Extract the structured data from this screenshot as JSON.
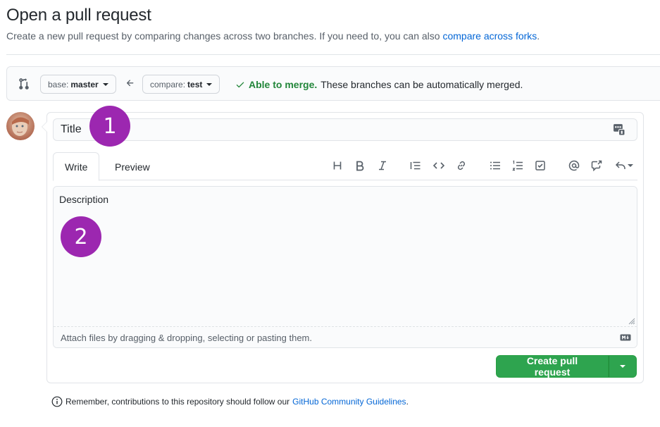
{
  "header": {
    "title": "Open a pull request",
    "subtitle": "Create a new pull request by comparing changes across two branches. If you need to, you can also",
    "subtitle_link": "compare across forks",
    "subtitle_end": "."
  },
  "range": {
    "base_label": "base:",
    "base_value": "master",
    "compare_label": "compare:",
    "compare_value": "test",
    "merge_ok": "Able to merge.",
    "merge_text": "These branches can be automatically merged."
  },
  "form": {
    "title_placeholder": "Title",
    "tabs": [
      "Write",
      "Preview"
    ],
    "toolbar_icons": [
      "heading-icon",
      "bold-icon",
      "italic-icon",
      "quote-icon",
      "code-icon",
      "link-icon",
      "bulleted-list-icon",
      "numbered-list-icon",
      "task-list-icon",
      "mention-icon",
      "reference-icon",
      "reply-icon"
    ],
    "description_placeholder": "Description",
    "attach_text": "Attach files by dragging & dropping, selecting or pasting them.",
    "submit_label": "Create pull request"
  },
  "footer": {
    "text": "Remember, contributions to this repository should follow our",
    "link": "GitHub Community Guidelines",
    "end": "."
  },
  "annotations": [
    "1",
    "2"
  ],
  "colors": {
    "link": "#0366d6",
    "success": "#22863a",
    "button_green": "#2ea44f",
    "badge_purple": "#9c27b0"
  }
}
